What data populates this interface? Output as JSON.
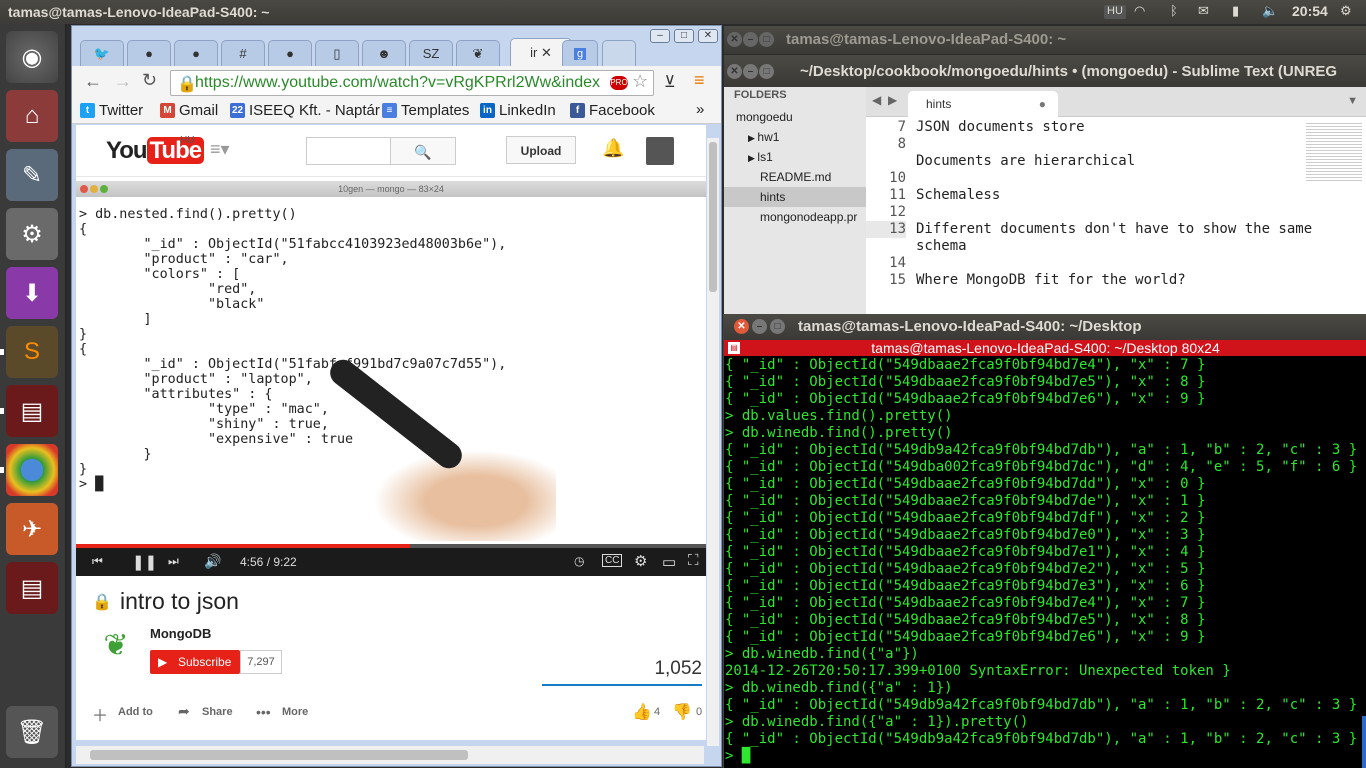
{
  "topbar": {
    "title": "tamas@tamas-Lenovo-IdeaPad-S400: ~",
    "keyboard": "HU",
    "time": "20:54"
  },
  "chrome": {
    "tabs": [
      {
        "icon": "twitter-icon",
        "glyph": "🐦"
      },
      {
        "icon": "github-icon",
        "glyph": "●"
      },
      {
        "icon": "github-icon",
        "glyph": "●"
      },
      {
        "icon": "hash-icon",
        "glyph": "#"
      },
      {
        "icon": "github-icon",
        "glyph": "●"
      },
      {
        "icon": "document-icon",
        "glyph": "▯"
      },
      {
        "icon": "android-icon",
        "glyph": "☻"
      },
      {
        "icon": "sz-icon",
        "glyph": "SZ"
      },
      {
        "icon": "mongodb-leaf-icon",
        "glyph": "❦"
      }
    ],
    "active_tab": "ir",
    "extra_tab_icon": "g",
    "url": "https://www.youtube.com/watch?v=vRgKPRrl2Ww&index",
    "bookmarks": [
      {
        "label": "Twitter",
        "icon": "twitter-icon",
        "color": "#1da1f2",
        "glyph": "t"
      },
      {
        "label": "Gmail",
        "icon": "gmail-icon",
        "color": "#d44638",
        "glyph": "M"
      },
      {
        "label": "ISEEQ Kft. - Naptár",
        "icon": "calendar-icon",
        "color": "#3b6fd6",
        "glyph": "22"
      },
      {
        "label": "Templates",
        "icon": "docs-icon",
        "color": "#4a7fe0",
        "glyph": "≡"
      },
      {
        "label": "LinkedIn",
        "icon": "linkedin-icon",
        "color": "#0a66c2",
        "glyph": "in"
      },
      {
        "label": "Facebook",
        "icon": "facebook-icon",
        "color": "#3b5998",
        "glyph": "f"
      }
    ],
    "bookmarks_more": "»"
  },
  "youtube": {
    "logo_you": "You",
    "logo_tube": "Tube",
    "region": "HU",
    "upload": "Upload",
    "video_window_title": "10gen — mongo — 83×24",
    "video_lines": [
      "> db.nested.find().pretty()",
      "{",
      "        \"_id\" : ObjectId(\"51fabcc4103923ed48003b6e\"),",
      "        \"product\" : \"car\",",
      "        \"colors\" : [",
      "                \"red\",",
      "                \"black\"",
      "        ]",
      "}",
      "{",
      "        \"_id\" : ObjectId(\"51fabfaf991bd7c9a07c7d55\"),",
      "        \"product\" : \"laptop\",",
      "        \"attributes\" : {",
      "                \"type\" : \"mac\",",
      "                \"shiny\" : true,",
      "                \"expensive\" : true",
      "        }",
      "}",
      "> █"
    ],
    "time": "4:56 / 9:22",
    "progress": 0.53,
    "video_title": "intro to json",
    "channel": "MongoDB",
    "subscribe": "Subscribe",
    "subscribers": "7,297",
    "views": "1,052",
    "add_to": "Add to",
    "share": "Share",
    "more": "More",
    "likes": "4",
    "dislikes": "0"
  },
  "sublime": {
    "title": "~/Desktop/cookbook/mongoedu/hints • (mongoedu) - Sublime Text (UNREG",
    "back_title": "tamas@tamas-Lenovo-IdeaPad-S400: ~",
    "folders_label": "FOLDERS",
    "tree": [
      {
        "label": "mongoedu",
        "level": 0,
        "arrow": ""
      },
      {
        "label": "hw1",
        "level": 1,
        "arrow": "▶"
      },
      {
        "label": "ls1",
        "level": 1,
        "arrow": "▶"
      },
      {
        "label": "README.md",
        "level": 2,
        "arrow": ""
      },
      {
        "label": "hints",
        "level": 2,
        "arrow": "",
        "selected": true
      },
      {
        "label": "mongonodeapp.pr",
        "level": 2,
        "arrow": ""
      }
    ],
    "tab": "hints",
    "line_numbers": [
      "7",
      "8",
      "10",
      "11",
      "12",
      "13",
      "",
      "14",
      "15"
    ],
    "code": [
      "JSON documents store",
      "",
      "Documents are hierarchical",
      "",
      "Schemaless",
      "",
      "Different documents don't have to show the same",
      "schema",
      "",
      "Where MongoDB fit for the world?"
    ]
  },
  "terminal": {
    "title": "tamas@tamas-Lenovo-IdeaPad-S400: ~/Desktop",
    "bar": "tamas@tamas-Lenovo-IdeaPad-S400: ~/Desktop 80x24",
    "lines": [
      "{ \"_id\" : ObjectId(\"549dbaae2fca9f0bf94bd7e4\"), \"x\" : 7 }",
      "{ \"_id\" : ObjectId(\"549dbaae2fca9f0bf94bd7e5\"), \"x\" : 8 }",
      "{ \"_id\" : ObjectId(\"549dbaae2fca9f0bf94bd7e6\"), \"x\" : 9 }",
      "> db.values.find().pretty()",
      "> db.winedb.find().pretty()",
      "{ \"_id\" : ObjectId(\"549db9a42fca9f0bf94bd7db\"), \"a\" : 1, \"b\" : 2, \"c\" : 3 }",
      "{ \"_id\" : ObjectId(\"549dba002fca9f0bf94bd7dc\"), \"d\" : 4, \"e\" : 5, \"f\" : 6 }",
      "{ \"_id\" : ObjectId(\"549dbaae2fca9f0bf94bd7dd\"), \"x\" : 0 }",
      "{ \"_id\" : ObjectId(\"549dbaae2fca9f0bf94bd7de\"), \"x\" : 1 }",
      "{ \"_id\" : ObjectId(\"549dbaae2fca9f0bf94bd7df\"), \"x\" : 2 }",
      "{ \"_id\" : ObjectId(\"549dbaae2fca9f0bf94bd7e0\"), \"x\" : 3 }",
      "{ \"_id\" : ObjectId(\"549dbaae2fca9f0bf94bd7e1\"), \"x\" : 4 }",
      "{ \"_id\" : ObjectId(\"549dbaae2fca9f0bf94bd7e2\"), \"x\" : 5 }",
      "{ \"_id\" : ObjectId(\"549dbaae2fca9f0bf94bd7e3\"), \"x\" : 6 }",
      "{ \"_id\" : ObjectId(\"549dbaae2fca9f0bf94bd7e4\"), \"x\" : 7 }",
      "{ \"_id\" : ObjectId(\"549dbaae2fca9f0bf94bd7e5\"), \"x\" : 8 }",
      "{ \"_id\" : ObjectId(\"549dbaae2fca9f0bf94bd7e6\"), \"x\" : 9 }",
      "> db.winedb.find({\"a\"})",
      "2014-12-26T20:50:17.399+0100 SyntaxError: Unexpected token }",
      "> db.winedb.find({\"a\" : 1})",
      "{ \"_id\" : ObjectId(\"549db9a42fca9f0bf94bd7db\"), \"a\" : 1, \"b\" : 2, \"c\" : 3 }",
      "> db.winedb.find({\"a\" : 1}).pretty()",
      "{ \"_id\" : ObjectId(\"549db9a42fca9f0bf94bd7db\"), \"a\" : 1, \"b\" : 2, \"c\" : 3 }",
      "> █"
    ]
  },
  "colors": {
    "terminal_green": "#2ee62e",
    "terminal_bar": "#d0121a",
    "yt_red": "#e62117",
    "sublime_bg": "#272822"
  }
}
